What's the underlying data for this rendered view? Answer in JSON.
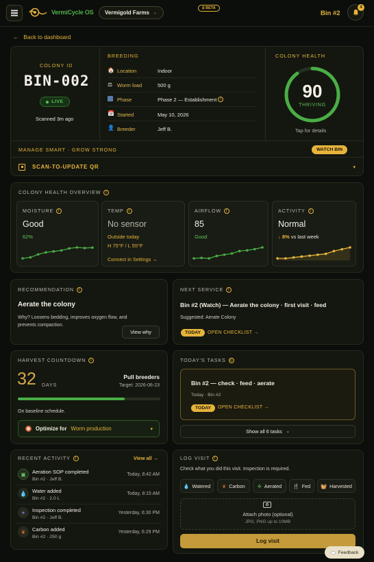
{
  "header": {
    "logo": "VermiCycle OS",
    "farm": "Vermigold Farms",
    "beta": "β BETA",
    "bin": "Bin #2",
    "notif_count": "4"
  },
  "back": "Back to dashboard",
  "colony": {
    "id_label": "COLONY ID",
    "id": "BIN-002",
    "status": "LIVE",
    "scanned": "Scanned 3m ago"
  },
  "breeding": {
    "title": "BREEDING",
    "rows": [
      {
        "k": "Location",
        "v": "Indoor"
      },
      {
        "k": "Worm load",
        "v": "500 g"
      },
      {
        "k": "Phase",
        "v": "Phase 2 — Establishment"
      },
      {
        "k": "Started",
        "v": "May 10, 2026"
      },
      {
        "k": "Breeder",
        "v": "Jeff B."
      }
    ]
  },
  "health": {
    "title": "COLONY HEALTH",
    "score": "90",
    "score_value": 90,
    "state": "THRIVING",
    "tap": "Tap for details"
  },
  "smart": {
    "title": "MANAGE SMART · GROW STRONG",
    "watch": "WATCH BIN",
    "qr": "SCAN-TO-UPDATE QR"
  },
  "overview": {
    "title": "COLONY HEALTH OVERVIEW",
    "moisture": {
      "label": "MOISTURE",
      "value": "Good",
      "sub": "62%",
      "trend": [
        2,
        2.5,
        4,
        5,
        5.5,
        6,
        7,
        7.5,
        7.2,
        7.4
      ]
    },
    "temp": {
      "label": "TEMP",
      "value": "No sensor",
      "sub": "Outside today",
      "sub2": "H 75°F / L 55°F",
      "link": "Connect in Settings"
    },
    "airflow": {
      "label": "AIRFLOW",
      "value": "85",
      "sub": "Good",
      "trend": [
        2,
        2.2,
        2,
        3,
        3.5,
        4,
        5,
        5.3,
        5.8,
        6.5
      ]
    },
    "activity": {
      "label": "ACTIVITY",
      "value": "Normal",
      "delta": "8%",
      "delta_text": "vs last week",
      "trend": [
        2,
        2,
        2.5,
        3,
        3.5,
        4,
        4.5,
        6,
        7,
        8
      ]
    }
  },
  "recommendation": {
    "title": "RECOMMENDATION",
    "heading": "Aerate the colony",
    "text": "Why? Loosens bedding, improves oxygen flow, and prevents compaction.",
    "button": "View why"
  },
  "next_service": {
    "title": "NEXT SERVICE",
    "heading": "Bin #2 (Watch) — Aerate the colony · first visit · feed",
    "suggested": "Suggested: Aerate Colony",
    "pill": "TODAY",
    "link": "OPEN CHECKLIST"
  },
  "harvest": {
    "title": "HARVEST COUNTDOWN",
    "days": "32",
    "days_label": "DAYS",
    "action": "Pull breeders",
    "target": "Target: 2026-06-23",
    "progress": 0.75,
    "note": "On baseline schedule.",
    "optimize_label": "Optimize for",
    "optimize_value": "Worm production"
  },
  "tasks": {
    "title": "TODAY'S TASKS",
    "task": "Bin #2 — check · feed · aerate",
    "meta": "Today · Bin #2",
    "pill": "TODAY",
    "link": "OPEN CHECKLIST",
    "show_all": "Show all 6 tasks"
  },
  "recent": {
    "title": "RECENT ACTIVITY",
    "view_all": "View all",
    "items": [
      {
        "title": "Aeration SOP completed",
        "sub": "Bin #2 · Jeff B.",
        "time": "Today, 8:42 AM"
      },
      {
        "title": "Water added",
        "sub": "Bin #2 · 2.0 L",
        "time": "Today, 8:15 AM"
      },
      {
        "title": "Inspection completed",
        "sub": "Bin #2 · Jeff B.",
        "time": "Yesterday, 6:30 PM"
      },
      {
        "title": "Carbon added",
        "sub": "Bin #2 · 250 g",
        "time": "Yesterday, 6:29 PM"
      }
    ]
  },
  "log": {
    "title": "LOG VISIT",
    "instr": "Check what you did this visit. Inspection is required.",
    "chips": [
      "Watered",
      "Carbon",
      "Aerated",
      "Fed",
      "Harvested"
    ],
    "photo": "Attach photo (optional)",
    "photo_hint": "JPG, PNG up to 10MB",
    "submit": "Log visit"
  },
  "feedback": "Feedback",
  "colors": {
    "accent": "#e6b43c",
    "good": "#5fc45a",
    "bg": "#0c0e0b",
    "card": "#14170f"
  }
}
